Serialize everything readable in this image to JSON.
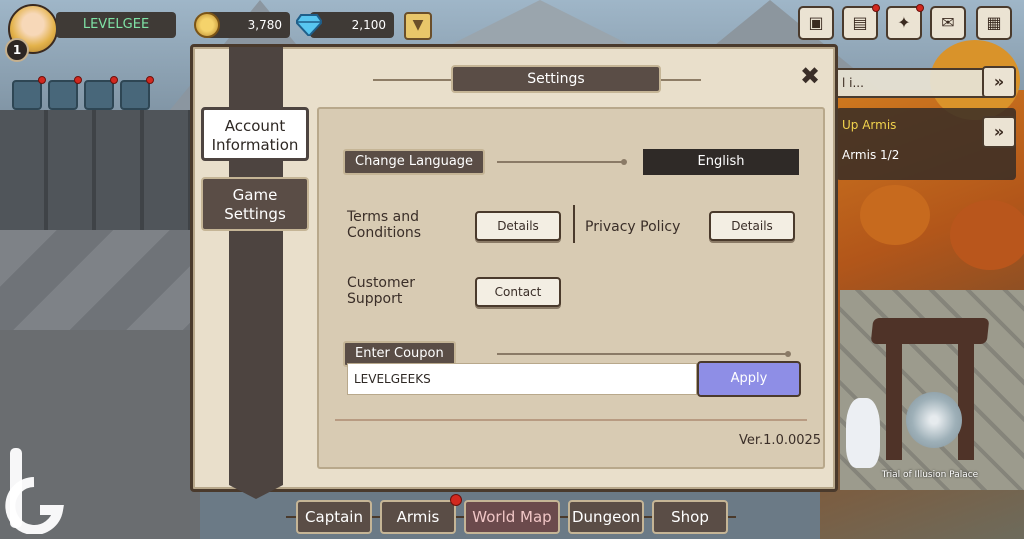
{
  "hud": {
    "player_name": "LEVELGEE",
    "level": "1",
    "gold": "3,780",
    "gems": "2,100",
    "avatar_icon": "player-portrait",
    "dropdown_icon": "chevron-down"
  },
  "top_right_buttons": [
    {
      "icon": "briefcase-icon",
      "glyph": "▣"
    },
    {
      "icon": "book-icon",
      "glyph": "▤"
    },
    {
      "icon": "star-spark-icon",
      "glyph": "✦"
    },
    {
      "icon": "mail-icon",
      "glyph": "✉"
    },
    {
      "icon": "checklist-grid-icon",
      "glyph": "▦"
    }
  ],
  "side": {
    "search_text": "l i...",
    "quest_title": "Up Armis",
    "quest_progress": "Armis 1/2",
    "arrow_glyph": "»"
  },
  "modal": {
    "title": "Settings",
    "close_glyph": "✖",
    "tabs": [
      {
        "label_line1": "Account",
        "label_line2": "Information"
      },
      {
        "label_line1": "Game",
        "label_line2": "Settings"
      }
    ],
    "language_section": "Change Language",
    "language_value": "English",
    "terms_label_line1": "Terms and",
    "terms_label_line2": "Conditions",
    "terms_button": "Details",
    "privacy_label": "Privacy Policy",
    "privacy_button": "Details",
    "support_label_line1": "Customer",
    "support_label_line2": "Support",
    "support_button": "Contact",
    "coupon_section": "Enter Coupon",
    "coupon_value": "LEVELGEEKS",
    "apply_button": "Apply",
    "version": "Ver.1.0.0025"
  },
  "scene": {
    "gate_label": "Trial of Illusion Palace"
  },
  "bottom_nav": [
    "Captain",
    "Armis",
    "World Map",
    "Dungeon",
    "Shop"
  ],
  "colors": {
    "accent_apply": "#8e8ee6",
    "panel_bg": "#e9dfcb",
    "dark_brown": "#5a4d46",
    "notification_red": "#d2281f"
  }
}
